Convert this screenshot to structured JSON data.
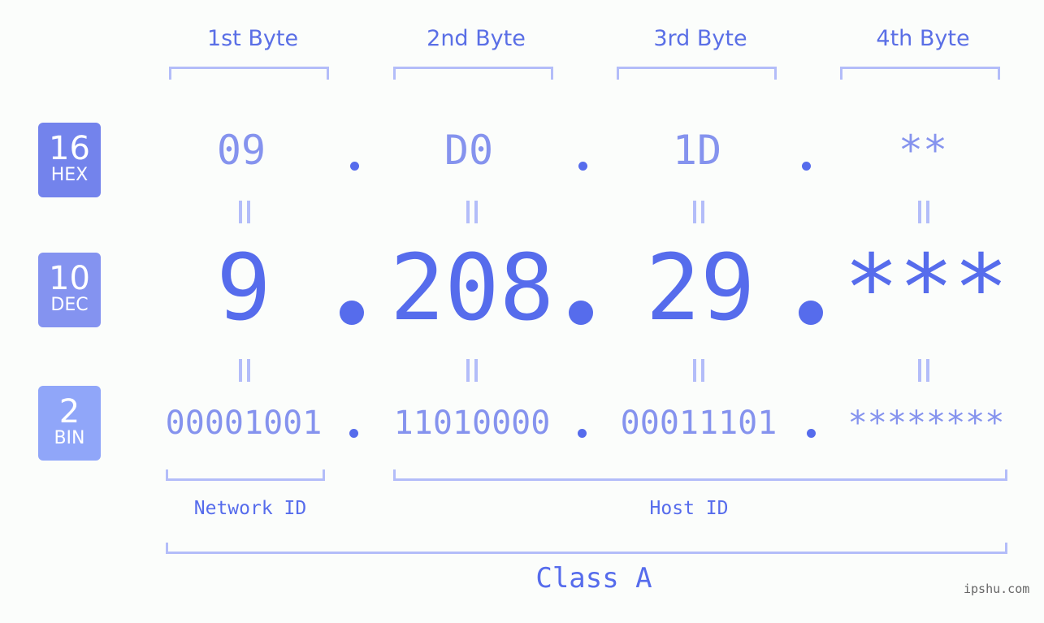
{
  "colors": {
    "background": "#fbfdfb",
    "primary": "#566cec",
    "secondary": "#8593ee",
    "bracket": "#b3bdf9",
    "hex_badge": "#7383ec",
    "dec_badge": "#8493f0",
    "bin_badge": "#90a6f9"
  },
  "byte_headers": [
    "1st Byte",
    "2nd Byte",
    "3rd Byte",
    "4th Byte"
  ],
  "rows": {
    "hex": {
      "base": "16",
      "label": "HEX",
      "values": [
        "09",
        "D0",
        "1D",
        "**"
      ],
      "separator": "."
    },
    "dec": {
      "base": "10",
      "label": "DEC",
      "values": [
        "9",
        "208",
        "29",
        "***"
      ],
      "separator": "."
    },
    "bin": {
      "base": "2",
      "label": "BIN",
      "values": [
        "00001001",
        "11010000",
        "00011101",
        "********"
      ],
      "separator": "."
    }
  },
  "equals_icon": "vertical-equals",
  "network_id_label": "Network ID",
  "host_id_label": "Host ID",
  "class_label": "Class A",
  "watermark": "ipshu.com"
}
